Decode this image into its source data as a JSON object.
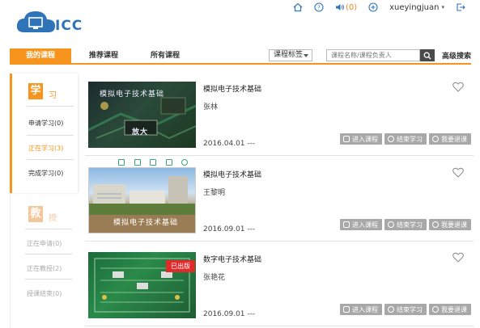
{
  "header": {
    "logo_text": "ICC",
    "notify_count": "(0)",
    "username": "xueyingjuan",
    "accent": "#f7941d",
    "brand_blue": "#2f73b8"
  },
  "nav": {
    "tabs": [
      {
        "label": "我的课程",
        "active": true
      },
      {
        "label": "推荐课程",
        "active": false
      },
      {
        "label": "所有课程",
        "active": false
      }
    ],
    "tag_select": "课程标签",
    "search_placeholder": "课程名称/课程负责人",
    "advanced_search": "高级搜索"
  },
  "sidebar": {
    "learn": {
      "big": "学",
      "small": "习",
      "items": [
        {
          "label": "申请学习(0)"
        },
        {
          "label": "正在学习(3)",
          "active": true
        },
        {
          "label": "完成学习(0)"
        }
      ]
    },
    "teach": {
      "big": "教",
      "small": "授",
      "items": [
        {
          "label": "正在申请(0)"
        },
        {
          "label": "正在教授(2)"
        },
        {
          "label": "授课结束(0)"
        }
      ]
    }
  },
  "courses": [
    {
      "title": "模拟电子技术基础",
      "teacher": "张林",
      "date": "2016.04.01 ---",
      "thumb_caption": "模拟电子技术基础",
      "thumb_sub": "放大"
    },
    {
      "title": "模拟电子技术基础",
      "teacher": "王黎明",
      "date": "2016.09.01 ---",
      "thumb_caption": "模拟电子技术基础"
    },
    {
      "title": "数字电子技术基础",
      "teacher": "张艳花",
      "date": "2016.09.01 ---",
      "badge": "已出版"
    }
  ],
  "actions": {
    "enter": "进入课程",
    "finish": "结束学习",
    "withdraw": "我要退课"
  }
}
